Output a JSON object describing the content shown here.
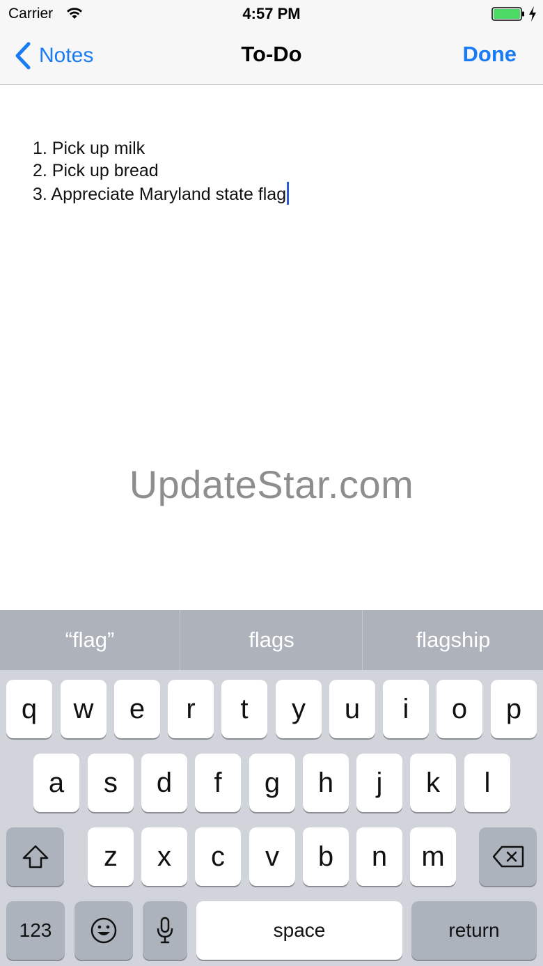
{
  "status_bar": {
    "carrier": "Carrier",
    "time": "4:57 PM",
    "battery_level_percent": 100,
    "battery_color": "#4cd964",
    "charging": true
  },
  "nav": {
    "back_label": "Notes",
    "title": "To-Do",
    "done_label": "Done",
    "accent_color": "#1a7cf5"
  },
  "note": {
    "lines": [
      "1. Pick up milk",
      "2. Pick up bread",
      "3. Appreciate Maryland state flag"
    ]
  },
  "watermark": "UpdateStar.com",
  "predictive": {
    "suggestions": [
      "“flag”",
      "flags",
      "flagship"
    ]
  },
  "keyboard": {
    "row1": [
      "q",
      "w",
      "e",
      "r",
      "t",
      "y",
      "u",
      "i",
      "o",
      "p"
    ],
    "row2": [
      "a",
      "s",
      "d",
      "f",
      "g",
      "h",
      "j",
      "k",
      "l"
    ],
    "row3": [
      "z",
      "x",
      "c",
      "v",
      "b",
      "n",
      "m"
    ],
    "numbers_label": "123",
    "space_label": "space",
    "return_label": "return",
    "icons": [
      "shift-icon",
      "backspace-icon",
      "emoji-icon",
      "microphone-icon"
    ]
  }
}
